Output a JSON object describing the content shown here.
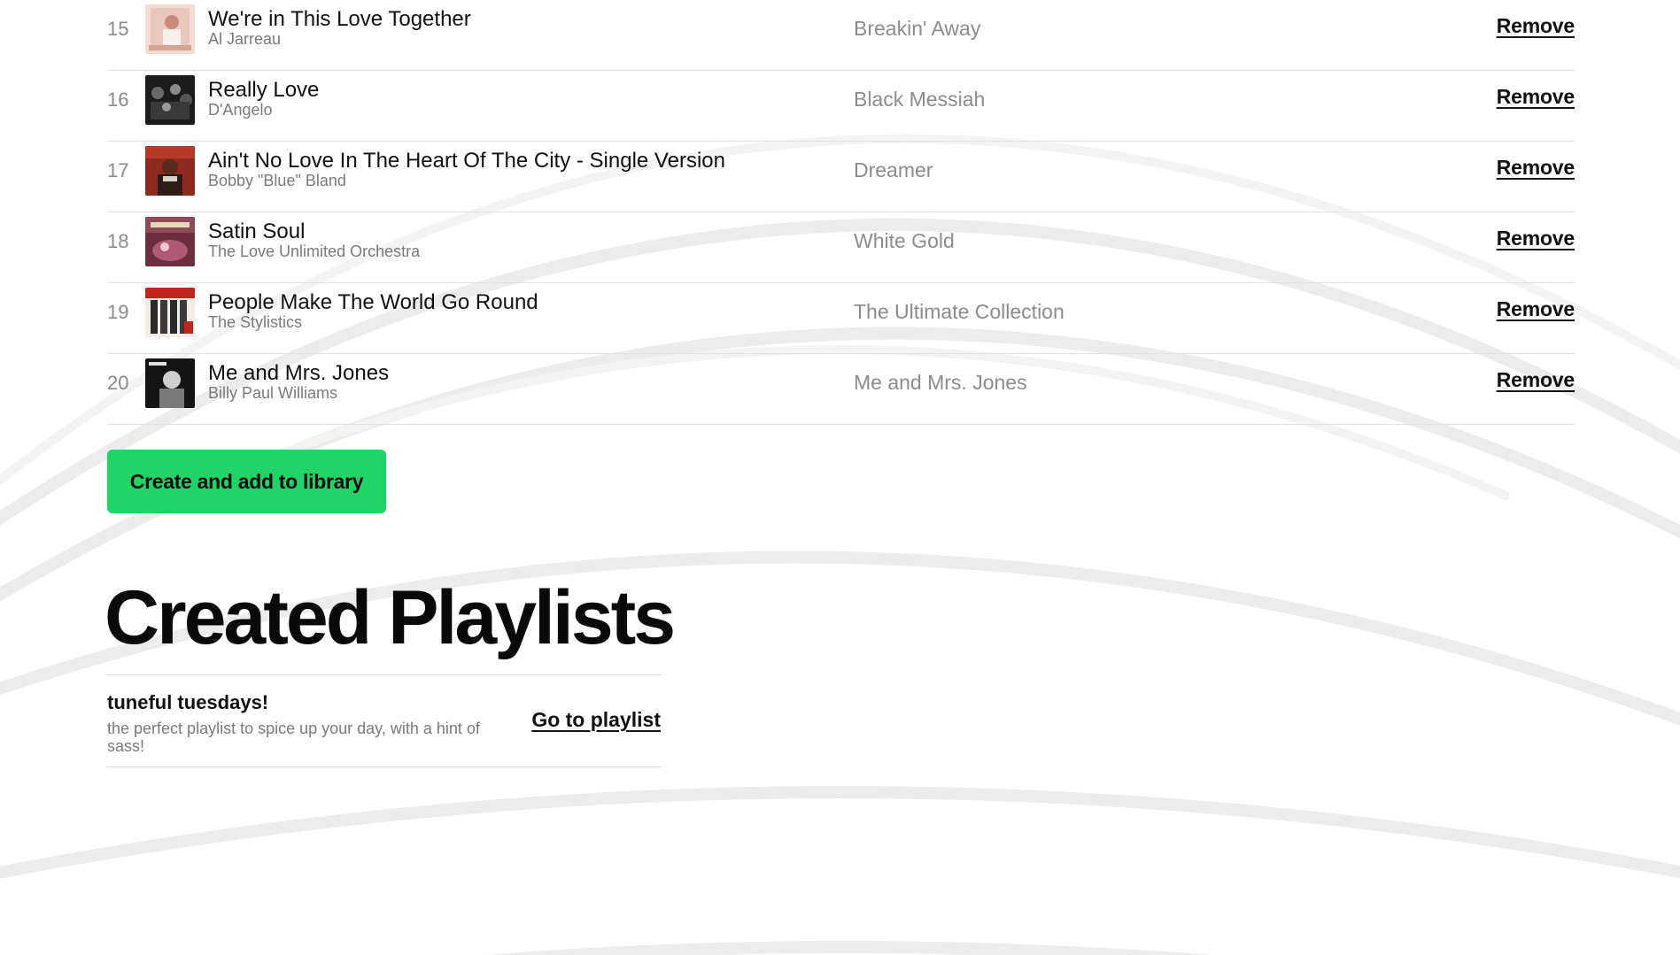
{
  "tracks": [
    {
      "number": "15",
      "title": "We're in This Love Together",
      "artist": "Al Jarreau",
      "album": "Breakin' Away",
      "remove_label": "Remove"
    },
    {
      "number": "16",
      "title": "Really Love",
      "artist": "D'Angelo",
      "album": "Black Messiah",
      "remove_label": "Remove"
    },
    {
      "number": "17",
      "title": "Ain't No Love In The Heart Of The City - Single Version",
      "artist": "Bobby \"Blue\" Bland",
      "album": "Dreamer",
      "remove_label": "Remove"
    },
    {
      "number": "18",
      "title": "Satin Soul",
      "artist": "The Love Unlimited Orchestra",
      "album": "White Gold",
      "remove_label": "Remove"
    },
    {
      "number": "19",
      "title": "People Make The World Go Round",
      "artist": "The Stylistics",
      "album": "The Ultimate Collection",
      "remove_label": "Remove"
    },
    {
      "number": "20",
      "title": "Me and Mrs. Jones",
      "artist": "Billy Paul Williams",
      "album": "Me and Mrs. Jones",
      "remove_label": "Remove"
    }
  ],
  "actions": {
    "create_button_label": "Create and add to library"
  },
  "created_playlists": {
    "heading": "Created Playlists",
    "items": [
      {
        "name": "tuneful tuesdays!",
        "description": "the perfect playlist to spice up your day, with a hint of sass!",
        "link_label": "Go to playlist"
      }
    ]
  },
  "colors": {
    "accent_green": "#21d466",
    "text_primary": "#111111",
    "text_secondary": "#7a7a7a",
    "divider": "#e1e1e1"
  },
  "icons": {
    "album_art": "album-art-image"
  }
}
